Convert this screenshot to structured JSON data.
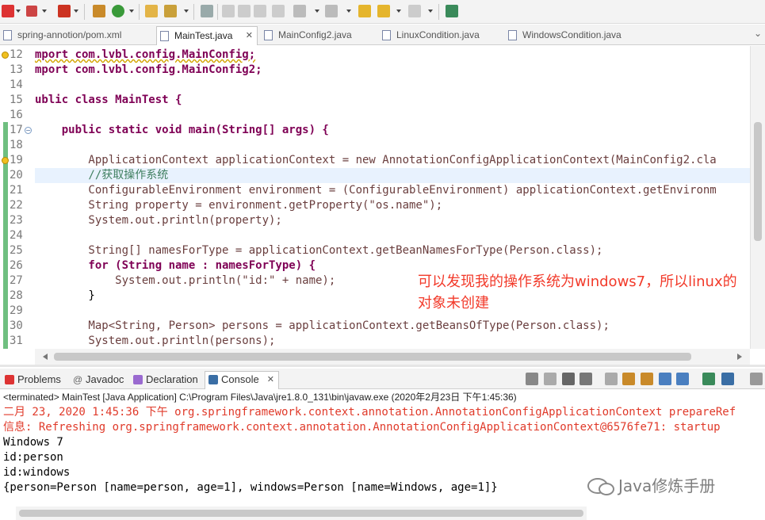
{
  "toolbar": {
    "icons": [
      "debug-icon",
      "stop-icon",
      "run-icon",
      "new-package-icon",
      "refresh-icon",
      "open-folder-icon",
      "wand-icon",
      "search-icon",
      "format-icon",
      "toggle-icon",
      "annotation-icon",
      "next-annotation-icon",
      "prev-annotation-icon",
      "back-icon",
      "forward-icon",
      "console-icon"
    ]
  },
  "tabs": {
    "items": [
      {
        "label": "spring-annotion/pom.xml",
        "active": false
      },
      {
        "label": "MainTest.java",
        "active": true
      },
      {
        "label": "MainConfig2.java",
        "active": false
      },
      {
        "label": "LinuxCondition.java",
        "active": false
      },
      {
        "label": "WindowsCondition.java",
        "active": false
      }
    ],
    "overflow": "⌄"
  },
  "editor": {
    "line_numbers": [
      "12",
      "13",
      "14",
      "15",
      "16",
      "17",
      "18",
      "19",
      "20",
      "21",
      "22",
      "23",
      "24",
      "25",
      "26",
      "27",
      "28",
      "29",
      "30",
      "31"
    ],
    "lines": [
      "mport com.lvbl.config.MainConfig;",
      "mport com.lvbl.config.MainConfig2;",
      "",
      "ublic class MainTest {",
      "",
      "    public static void main(String[] args) {",
      "",
      "        ApplicationContext applicationContext = new AnnotationConfigApplicationContext(MainConfig2.cla",
      "        //获取操作系统",
      "        ConfigurableEnvironment environment = (ConfigurableEnvironment) applicationContext.getEnvironm",
      "        String property = environment.getProperty(\"os.name\");",
      "        System.out.println(property);",
      "",
      "        String[] namesForType = applicationContext.getBeanNamesForType(Person.class);",
      "        for (String name : namesForType) {",
      "            System.out.println(\"id:\" + name);",
      "        }",
      "",
      "        Map<String, Person> persons = applicationContext.getBeansOfType(Person.class);",
      "        System.out.println(persons);"
    ],
    "annotation": "可以发现我的操作系统为windows7，所以linux的对象未创建"
  },
  "panel": {
    "tabs": [
      {
        "label": "Problems",
        "icon": "problems-icon"
      },
      {
        "label": "Javadoc",
        "icon": "javadoc-icon"
      },
      {
        "label": "Declaration",
        "icon": "declaration-icon"
      },
      {
        "label": "Console",
        "icon": "console-icon",
        "active": true
      }
    ],
    "console_header": "<terminated> MainTest [Java Application] C:\\Program Files\\Java\\jre1.8.0_131\\bin\\javaw.exe (2020年2月23日 下午1:45:36)",
    "console_lines": [
      {
        "text": "二月 23, 2020 1:45:36 下午 org.springframework.context.annotation.AnnotationConfigApplicationContext prepareRef",
        "kind": "err"
      },
      {
        "text": "信息: Refreshing org.springframework.context.annotation.AnnotationConfigApplicationContext@6576fe71: startup",
        "kind": "err"
      },
      {
        "text": "Windows 7",
        "kind": "out"
      },
      {
        "text": "id:person",
        "kind": "out"
      },
      {
        "text": "id:windows",
        "kind": "out"
      },
      {
        "text": "{person=Person [name=person, age=1], windows=Person [name=Windows, age=1]}",
        "kind": "out"
      }
    ],
    "watermark": "Java修炼手册"
  }
}
